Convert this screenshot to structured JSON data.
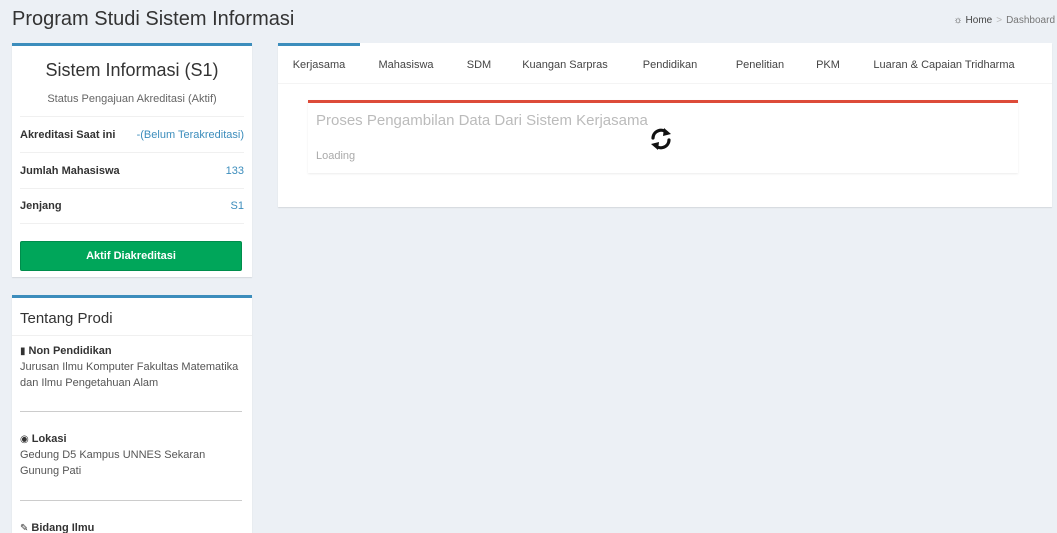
{
  "header": {
    "title": "Program Studi Sistem Informasi",
    "breadcrumb": {
      "home": "Home",
      "current": "Dashboard"
    }
  },
  "profile": {
    "name": "Sistem Informasi (S1)",
    "status": "Status Pengajuan Akreditasi (Aktif)",
    "rows": [
      {
        "label": "Akreditasi Saat ini",
        "value": "-(Belum Terakreditasi)"
      },
      {
        "label": "Jumlah Mahasiswa",
        "value": "133"
      },
      {
        "label": "Jenjang",
        "value": "S1"
      }
    ],
    "button": "Aktif Diakreditasi"
  },
  "about": {
    "title": "Tentang Prodi",
    "sections": [
      {
        "icon": "book-icon",
        "heading": "Non Pendidikan",
        "body": "Jurusan Ilmu Komputer Fakultas Matematika dan Ilmu Pengetahuan Alam"
      },
      {
        "icon": "map-marker-icon",
        "heading": "Lokasi",
        "body": "Gedung D5 Kampus UNNES Sekaran Gunung Pati"
      },
      {
        "icon": "pencil-icon",
        "heading": "Bidang Ilmu",
        "body": ""
      }
    ]
  },
  "tabs": [
    {
      "label": "Kerjasama",
      "active": true
    },
    {
      "label": "Mahasiswa"
    },
    {
      "label": "SDM"
    },
    {
      "label": "Kuangan Sarpras"
    },
    {
      "label": "Pendidikan"
    },
    {
      "label": "Penelitian"
    },
    {
      "label": "PKM"
    },
    {
      "label": "Luaran & Capaian Tridharma"
    }
  ],
  "loading": {
    "title": "Proses Pengambilan Data Dari Sistem Kerjasama",
    "text": "Loading"
  },
  "colors": {
    "accent": "#3c8dbc",
    "success": "#00a65a",
    "danger": "#dd4b39"
  }
}
